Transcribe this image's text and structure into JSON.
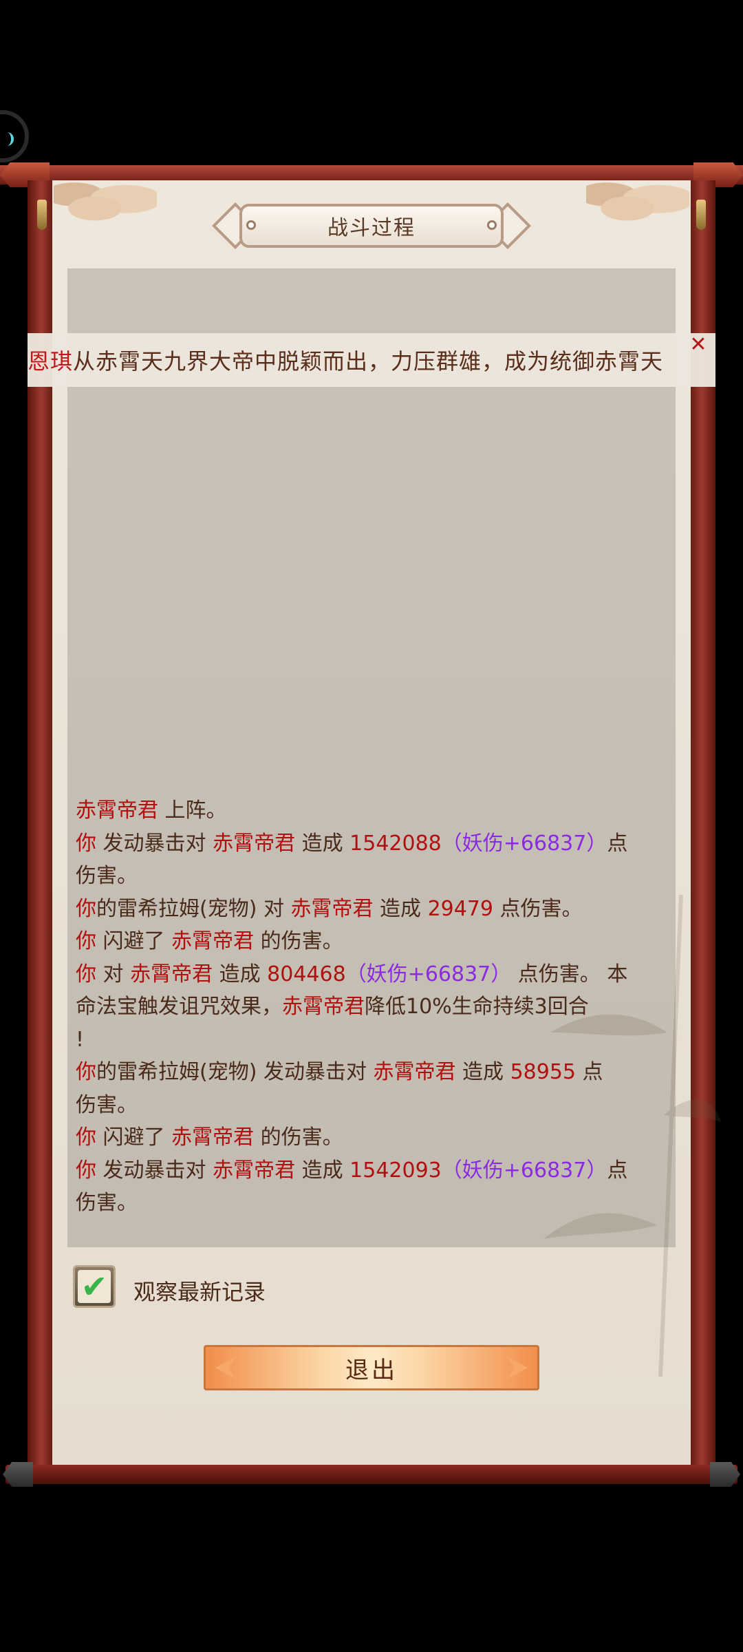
{
  "header": {
    "title": "战斗过程"
  },
  "marquee": {
    "name": "恩琪",
    "message": "从赤霄天九界大帝中脱颖而出，力压群雄，成为统御赤霄天"
  },
  "log": {
    "lines": [
      [
        {
          "t": "赤霄帝君",
          "c": "red"
        },
        {
          "t": " 上阵。",
          "c": "normal"
        }
      ],
      [
        {
          "t": "你",
          "c": "red"
        },
        {
          "t": " 发动暴击对 ",
          "c": "normal"
        },
        {
          "t": "赤霄帝君",
          "c": "red"
        },
        {
          "t": " 造成 ",
          "c": "normal"
        },
        {
          "t": "1542088",
          "c": "red"
        },
        {
          "t": "（妖伤+66837）",
          "c": "purple"
        },
        {
          "t": "点",
          "c": "normal"
        }
      ],
      [
        {
          "t": "伤害。",
          "c": "normal"
        }
      ],
      [
        {
          "t": "你",
          "c": "red"
        },
        {
          "t": "的雷希拉姆(宠物) 对 ",
          "c": "normal"
        },
        {
          "t": "赤霄帝君",
          "c": "red"
        },
        {
          "t": " 造成 ",
          "c": "normal"
        },
        {
          "t": "29479",
          "c": "red"
        },
        {
          "t": " 点伤害。",
          "c": "normal"
        }
      ],
      [
        {
          "t": "你",
          "c": "red"
        },
        {
          "t": " 闪避了 ",
          "c": "normal"
        },
        {
          "t": "赤霄帝君",
          "c": "red"
        },
        {
          "t": " 的伤害。",
          "c": "normal"
        }
      ],
      [
        {
          "t": "你",
          "c": "red"
        },
        {
          "t": " 对 ",
          "c": "normal"
        },
        {
          "t": "赤霄帝君",
          "c": "red"
        },
        {
          "t": " 造成 ",
          "c": "normal"
        },
        {
          "t": "804468",
          "c": "red"
        },
        {
          "t": "（妖伤+66837）",
          "c": "purple"
        },
        {
          "t": " 点伤害。 本",
          "c": "normal"
        }
      ],
      [
        {
          "t": "命法宝触发诅咒效果，",
          "c": "normal"
        },
        {
          "t": "赤霄帝君",
          "c": "red"
        },
        {
          "t": "降低10%生命持续3回合",
          "c": "normal"
        }
      ],
      [
        {
          "t": "!",
          "c": "normal"
        }
      ],
      [
        {
          "t": "你",
          "c": "red"
        },
        {
          "t": "的雷希拉姆(宠物) 发动暴击对 ",
          "c": "normal"
        },
        {
          "t": "赤霄帝君",
          "c": "red"
        },
        {
          "t": " 造成 ",
          "c": "normal"
        },
        {
          "t": "58955",
          "c": "red"
        },
        {
          "t": " 点",
          "c": "normal"
        }
      ],
      [
        {
          "t": "伤害。",
          "c": "normal"
        }
      ],
      [
        {
          "t": "你",
          "c": "red"
        },
        {
          "t": " 闪避了 ",
          "c": "normal"
        },
        {
          "t": "赤霄帝君",
          "c": "red"
        },
        {
          "t": " 的伤害。",
          "c": "normal"
        }
      ],
      [
        {
          "t": "你",
          "c": "red"
        },
        {
          "t": " 发动暴击对 ",
          "c": "normal"
        },
        {
          "t": "赤霄帝君",
          "c": "red"
        },
        {
          "t": " 造成 ",
          "c": "normal"
        },
        {
          "t": "1542093",
          "c": "red"
        },
        {
          "t": "（妖伤+66837）",
          "c": "purple"
        },
        {
          "t": "点",
          "c": "normal"
        }
      ],
      [
        {
          "t": "伤害。",
          "c": "normal"
        }
      ]
    ]
  },
  "footer": {
    "watch_latest_label": "观察最新记录",
    "watch_latest_checked": true,
    "exit_label": "退出"
  },
  "colors": {
    "name_red": "#b01010",
    "bonus_purple": "#8a2be2",
    "text_brown": "#4a2a1a",
    "frame_red": "#8c2a20",
    "check_green": "#39b54a"
  },
  "icons": {
    "close": "close-icon",
    "check": "checkmark-icon"
  }
}
